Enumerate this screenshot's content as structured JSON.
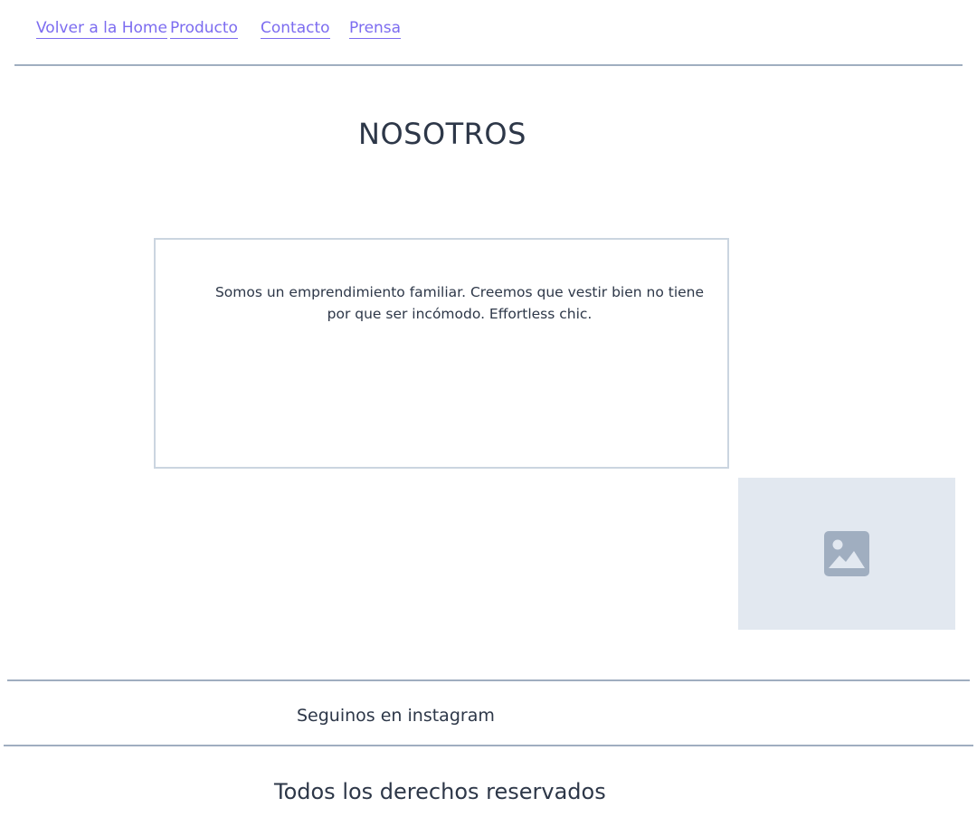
{
  "nav": {
    "items": [
      {
        "label": "Volver a la Home"
      },
      {
        "label": "Producto"
      },
      {
        "label": "Contacto"
      },
      {
        "label": "Prensa"
      }
    ]
  },
  "main": {
    "title": "NOSOTROS",
    "about_text": "Somos un emprendimiento familiar. Creemos que vestir bien no tiene por que ser incómodo. Effortless chic.",
    "image_icon": "image-icon"
  },
  "social": {
    "instagram_label": "Seguinos en instagram"
  },
  "footer": {
    "copyright": "Todos los derechos reservados"
  },
  "colors": {
    "link": "#7c6cf0",
    "text": "#2d3748",
    "divider": "#a0aec0",
    "box_border": "#cbd5e0",
    "placeholder_bg": "#e2e8f0",
    "placeholder_icon": "#a0aec0"
  }
}
